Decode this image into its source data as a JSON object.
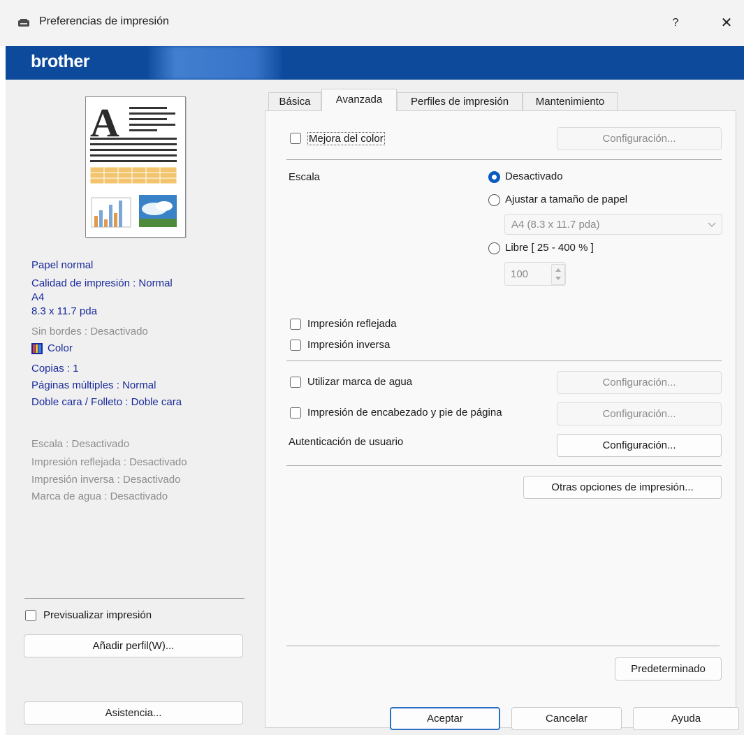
{
  "window": {
    "title": "Preferencias de impresión",
    "help_label": "?",
    "close_label": "✕"
  },
  "banner": {
    "logo": "brother"
  },
  "preview": {
    "letter": "A"
  },
  "summary": {
    "paper_type": "Papel normal",
    "quality": "Calidad de impresión : Normal",
    "size": "A4",
    "dimensions": "8.3 x 11.7 pda",
    "borderless": "Sin bordes : Desactivado",
    "color": "Color",
    "copies": "Copias : 1",
    "multipage": "Páginas múltiples : Normal",
    "duplex": "Doble cara / Folleto : Doble cara",
    "scale": "Escala : Desactivado",
    "mirror": "Impresión reflejada : Desactivado",
    "reverse": "Impresión inversa : Desactivado",
    "watermark": "Marca de agua : Desactivado"
  },
  "left_controls": {
    "preview_checkbox": "Previsualizar impresión",
    "add_profile": "Añadir perfil(W)...",
    "support": "Asistencia..."
  },
  "tabs": [
    "Básica",
    "Avanzada",
    "Perfiles de impresión",
    "Mantenimiento"
  ],
  "active_tab": "Avanzada",
  "advanced": {
    "color_enhance": "Mejora del color",
    "config_label": "Configuración...",
    "scale_label": "Escala",
    "scale_off": "Desactivado",
    "scale_fit": "Ajustar a tamaño de papel",
    "paper_select": "A4 (8.3 x 11.7 pda)",
    "scale_free": "Libre [ 25 - 400 % ]",
    "scale_value": "100",
    "mirror": "Impresión reflejada",
    "reverse": "Impresión inversa",
    "watermark": "Utilizar marca de agua",
    "header_footer": "Impresión de encabezado y pie de página",
    "user_auth": "Autenticación de usuario",
    "other_options": "Otras opciones de impresión...",
    "default": "Predeterminado"
  },
  "footer": {
    "ok": "Aceptar",
    "cancel": "Cancelar",
    "help": "Ayuda"
  },
  "colors": {
    "banner": "#0d4a9c",
    "info_text": "#1a2a9a",
    "accent": "#0a5bc0"
  }
}
